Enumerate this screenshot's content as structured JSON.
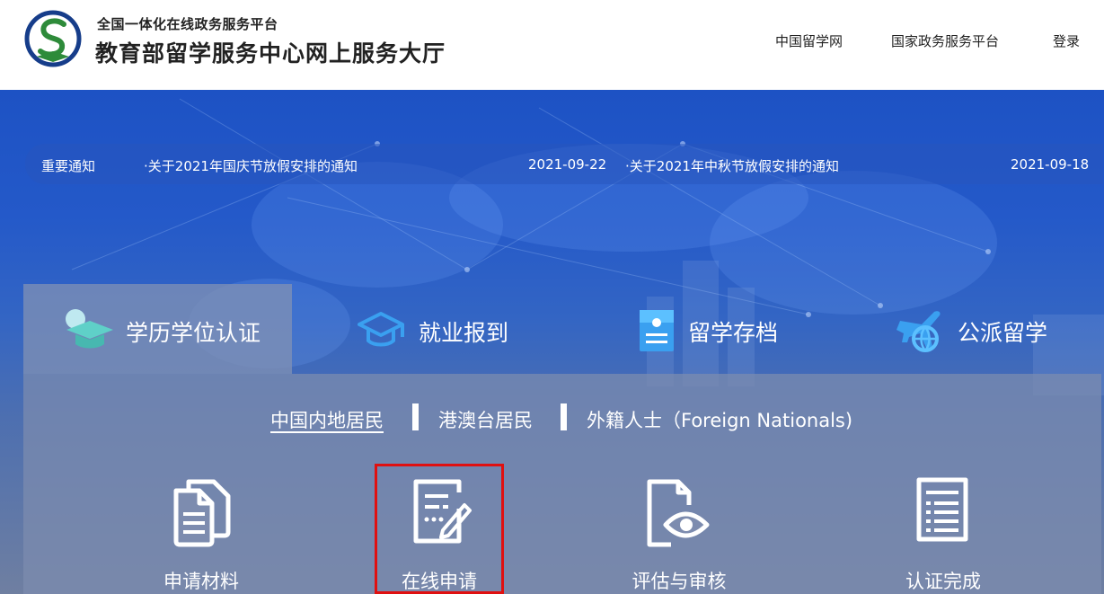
{
  "header": {
    "sub_title": "全国一体化在线政务服务平台",
    "main_title": "教育部留学服务中心网上服务大厅",
    "nav": [
      "中国留学网",
      "国家政务服务平台",
      "登录"
    ]
  },
  "notice": {
    "label": "重要通知",
    "items": [
      {
        "title": "关于2021年国庆节放假安排的通知",
        "date": "2021-09-22"
      },
      {
        "title": "关于2021年中秋节放假安排的通知",
        "date": "2021-09-18"
      }
    ]
  },
  "service_tabs": [
    {
      "label": "学历学位认证",
      "icon": "graduation-cap-icon",
      "active": true
    },
    {
      "label": "就业报到",
      "icon": "cap-badge-icon",
      "active": false
    },
    {
      "label": "留学存档",
      "icon": "archive-icon",
      "active": false
    },
    {
      "label": "公派留学",
      "icon": "plane-globe-icon",
      "active": false
    }
  ],
  "sub_tabs": [
    {
      "label": "中国内地居民",
      "active": true
    },
    {
      "label": "港澳台居民",
      "active": false
    },
    {
      "label": "外籍人士（Foreign Nationals)",
      "active": false
    }
  ],
  "steps": [
    {
      "label": "申请材料",
      "icon": "documents-icon"
    },
    {
      "label": "在线申请",
      "icon": "form-edit-icon",
      "highlighted": true
    },
    {
      "label": "评估与审核",
      "icon": "document-eye-icon"
    },
    {
      "label": "认证完成",
      "icon": "checklist-icon"
    }
  ],
  "colors": {
    "highlight_border": "#e01010",
    "brand_blue": "#1d52c4",
    "logo_green": "#2e8b3a"
  }
}
